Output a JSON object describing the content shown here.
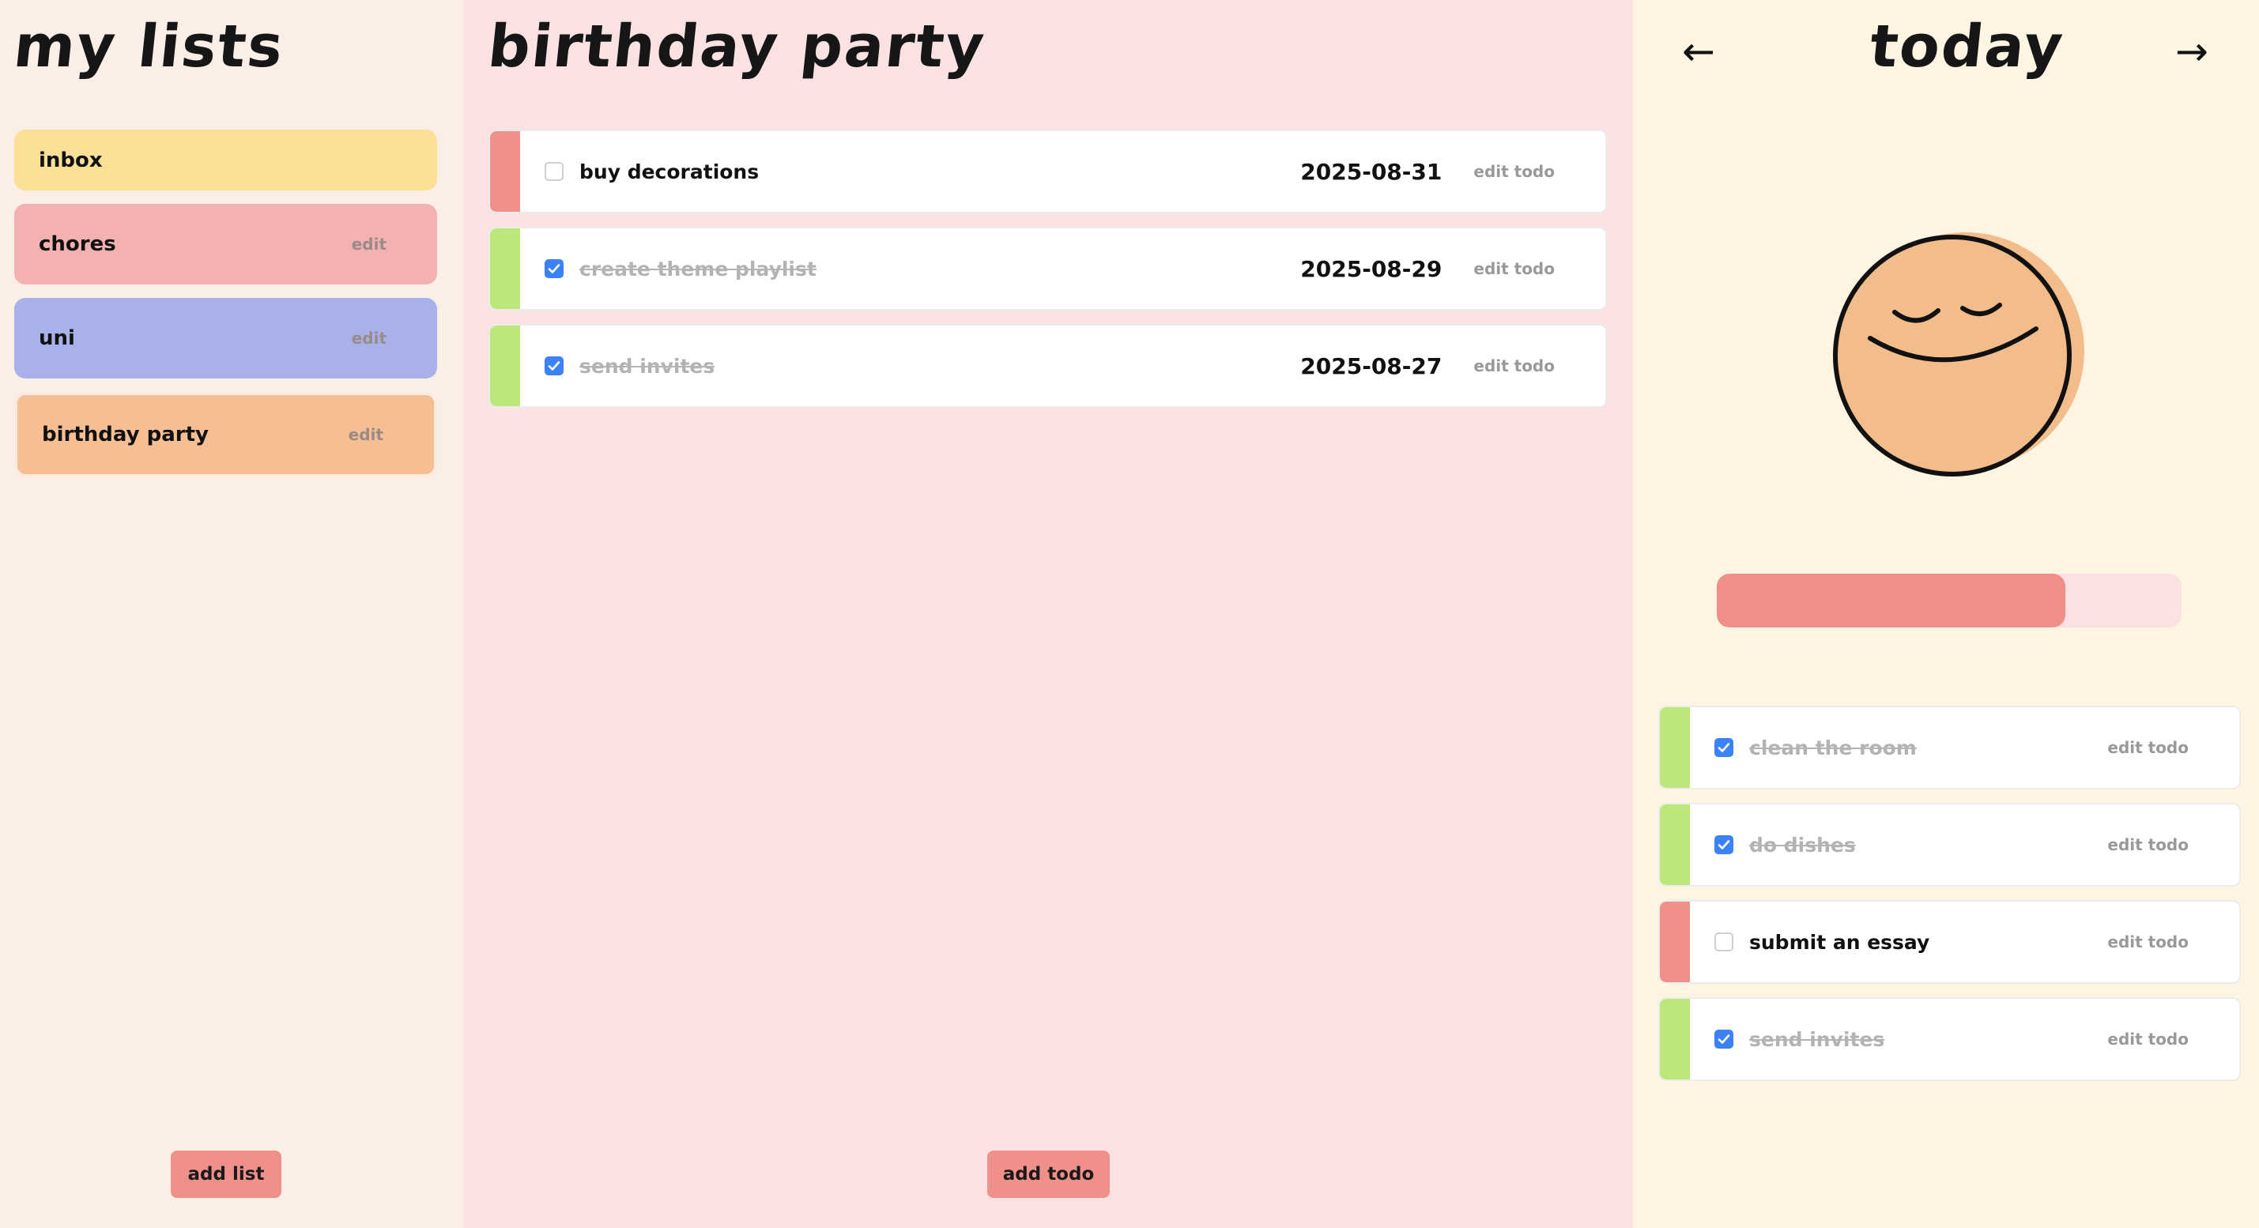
{
  "sidebar": {
    "title": "my lists",
    "lists": [
      {
        "label": "inbox",
        "color": "#fbe096",
        "edit": ""
      },
      {
        "label": "chores",
        "color": "#f4b1b1",
        "edit": "edit"
      },
      {
        "label": "uni",
        "color": "#a8b1ea",
        "edit": "edit"
      },
      {
        "label": "birthday party",
        "color": "#f6bf93",
        "edit": "edit",
        "selected": true
      }
    ],
    "add_label": "add list"
  },
  "main": {
    "title": "birthday party",
    "todos": [
      {
        "title": "buy decorations",
        "date": "2025-08-31",
        "done": false,
        "edit": "edit todo"
      },
      {
        "title": "create theme playlist",
        "date": "2025-08-29",
        "done": true,
        "edit": "edit todo"
      },
      {
        "title": "send invites",
        "date": "2025-08-27",
        "done": true,
        "edit": "edit todo"
      }
    ],
    "add_label": "add todo"
  },
  "today": {
    "title": "today",
    "prev_icon": "arrow-left-icon",
    "next_icon": "arrow-right-icon",
    "prev_glyph": "←",
    "next_glyph": "→",
    "mood_icon": "smiley-face-icon",
    "progress": 0.75,
    "todos": [
      {
        "title": "clean the room",
        "done": true,
        "edit": "edit todo"
      },
      {
        "title": "do dishes",
        "done": true,
        "edit": "edit todo"
      },
      {
        "title": "submit an essay",
        "done": false,
        "edit": "edit todo"
      },
      {
        "title": "send invites",
        "done": true,
        "edit": "edit todo"
      }
    ]
  },
  "colors": {
    "accent": "#f0908a",
    "done_bar": "#bde77a",
    "check": "#3b82f6"
  }
}
